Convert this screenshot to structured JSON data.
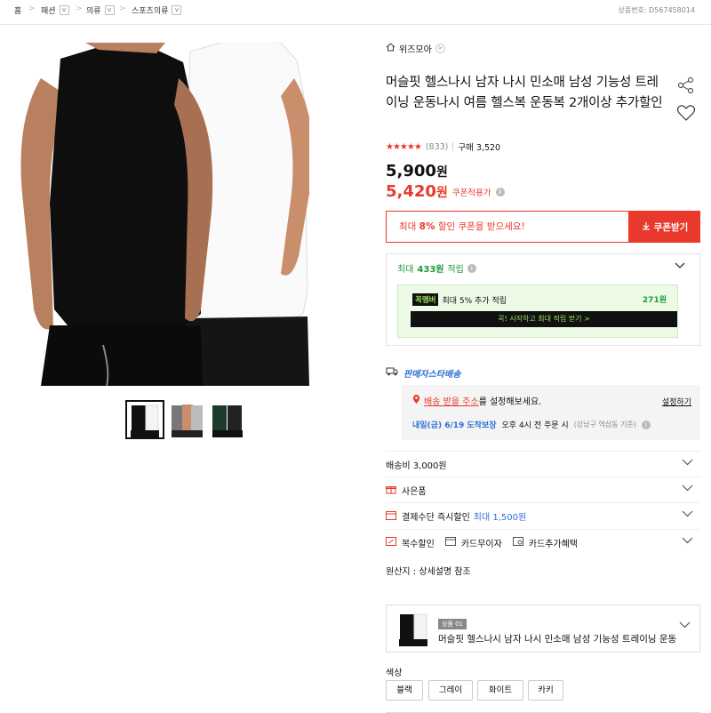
{
  "breadcrumb": {
    "home": "홈",
    "items": [
      {
        "label": "패션"
      },
      {
        "label": "의류"
      },
      {
        "label": "스포츠의류"
      }
    ]
  },
  "product_number": "상품번호: D567458014",
  "seller": {
    "name": "위즈모아"
  },
  "product": {
    "title": "머슬핏 헬스나시 남자 나시 민소매 남성 기능성 트레이닝 운동나시 여름 헬스복 운동복 2개이상 추가할인",
    "rating_count": "(833)",
    "purchase_count": "구매 3,520",
    "price_original": "5,900",
    "price_coupon": "5,420",
    "currency": "원",
    "coupon_tag": "쿠폰적용가"
  },
  "coupon": {
    "text_prefix": "최대",
    "text_rate": "8%",
    "text_suffix": "할인 쿠폰을 받으세요!",
    "button": "쿠폰받기"
  },
  "points": {
    "title_prefix": "최대",
    "title_amount": "433원",
    "title_suffix": "적립",
    "member_badge": "꼭멤버",
    "member_text": "최대 5% 추가 적립",
    "member_amount": "271원",
    "member_cta": "꼭! 시작하고 최대 적립 받기 >"
  },
  "shipping": {
    "brand": "판매자스타배송",
    "address_link": "배송 받을 주소",
    "address_suffix": "를 설정해보세요.",
    "set_link": "설정하기",
    "arrival": "내일(금) 6/19 도착보장",
    "cutoff": "오후 4시 전 주문 시",
    "region": "(강남구 역삼동 기준)"
  },
  "rows": [
    {
      "label": "배송비 3,000원",
      "extra": ""
    },
    {
      "label": "사은품",
      "extra": ""
    },
    {
      "label": "결제수단 즉시할인",
      "extra": "최대 1,500원"
    }
  ],
  "benefits": [
    "복수할인",
    "카드무이자",
    "카드추가혜택"
  ],
  "origin": "원산지 : 상세설명 참조",
  "option": {
    "badge": "상품 01",
    "text": "머슬핏 헬스나시 남자 나시 민소매 남성 기능성 트레이닝 운동..."
  },
  "color": {
    "label": "색상",
    "options": [
      "블랙",
      "그레이",
      "화이트",
      "카키"
    ]
  },
  "colors": {
    "accent": "#e8392c",
    "green": "#1e9b3e",
    "blue": "#2b6fd6"
  }
}
